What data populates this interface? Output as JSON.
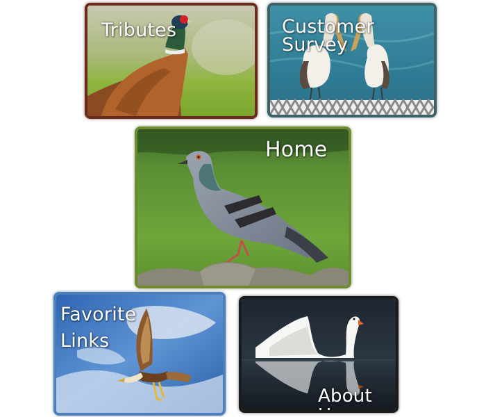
{
  "tiles": {
    "tributes": {
      "label": "Tributes",
      "image": "pheasant-image"
    },
    "survey": {
      "label": "Customer\nSurvey",
      "image": "pelicans-image"
    },
    "home": {
      "label": "Home",
      "image": "pigeon-image"
    },
    "links": {
      "label": "Favorite\nLinks",
      "image": "hawk-image"
    },
    "about": {
      "label": "About Us",
      "image": "swan-image"
    }
  },
  "colors": {
    "tributes_border": "#6a2a1e",
    "survey_border": "#3e6168",
    "home_border": "#6d8b30",
    "links_border": "#4f7fb8",
    "about_border": "#1b1b1b"
  }
}
